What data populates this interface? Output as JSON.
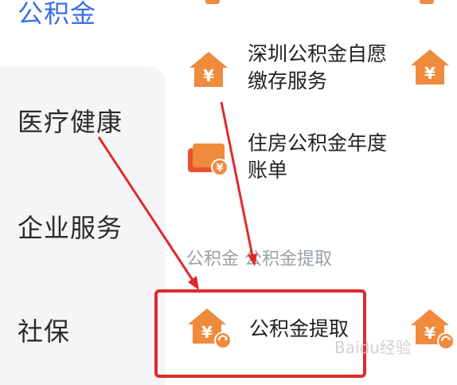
{
  "sidebar": {
    "active": "公积金",
    "items": [
      "医疗健康",
      "企业服务",
      "社保"
    ]
  },
  "services": {
    "shenzhen": {
      "line1": "深圳公积金自愿",
      "line2": "缴存服务",
      "icon": "house-yuan-icon"
    },
    "annual": {
      "line1": "住房公积金年度",
      "line2": "账单",
      "icon": "bill-card-icon"
    },
    "section_label": "公积金 公积金提取",
    "withdraw": {
      "label": "公积金提取",
      "icon": "house-yuan-refresh-icon"
    }
  },
  "watermark": "Baidu经验",
  "colors": {
    "accent": "#3a6fe8",
    "icon_orange": "#f08a3c",
    "annotation_red": "#e02a2a"
  }
}
